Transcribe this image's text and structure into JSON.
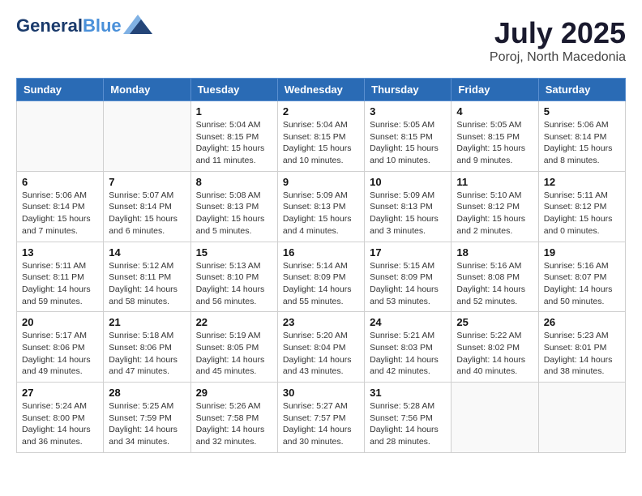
{
  "header": {
    "logo_line1": "General",
    "logo_line2": "Blue",
    "month_year": "July 2025",
    "location": "Poroj, North Macedonia"
  },
  "days_of_week": [
    "Sunday",
    "Monday",
    "Tuesday",
    "Wednesday",
    "Thursday",
    "Friday",
    "Saturday"
  ],
  "weeks": [
    [
      {
        "day": "",
        "info": ""
      },
      {
        "day": "",
        "info": ""
      },
      {
        "day": "1",
        "info": "Sunrise: 5:04 AM\nSunset: 8:15 PM\nDaylight: 15 hours and 11 minutes."
      },
      {
        "day": "2",
        "info": "Sunrise: 5:04 AM\nSunset: 8:15 PM\nDaylight: 15 hours and 10 minutes."
      },
      {
        "day": "3",
        "info": "Sunrise: 5:05 AM\nSunset: 8:15 PM\nDaylight: 15 hours and 10 minutes."
      },
      {
        "day": "4",
        "info": "Sunrise: 5:05 AM\nSunset: 8:15 PM\nDaylight: 15 hours and 9 minutes."
      },
      {
        "day": "5",
        "info": "Sunrise: 5:06 AM\nSunset: 8:14 PM\nDaylight: 15 hours and 8 minutes."
      }
    ],
    [
      {
        "day": "6",
        "info": "Sunrise: 5:06 AM\nSunset: 8:14 PM\nDaylight: 15 hours and 7 minutes."
      },
      {
        "day": "7",
        "info": "Sunrise: 5:07 AM\nSunset: 8:14 PM\nDaylight: 15 hours and 6 minutes."
      },
      {
        "day": "8",
        "info": "Sunrise: 5:08 AM\nSunset: 8:13 PM\nDaylight: 15 hours and 5 minutes."
      },
      {
        "day": "9",
        "info": "Sunrise: 5:09 AM\nSunset: 8:13 PM\nDaylight: 15 hours and 4 minutes."
      },
      {
        "day": "10",
        "info": "Sunrise: 5:09 AM\nSunset: 8:13 PM\nDaylight: 15 hours and 3 minutes."
      },
      {
        "day": "11",
        "info": "Sunrise: 5:10 AM\nSunset: 8:12 PM\nDaylight: 15 hours and 2 minutes."
      },
      {
        "day": "12",
        "info": "Sunrise: 5:11 AM\nSunset: 8:12 PM\nDaylight: 15 hours and 0 minutes."
      }
    ],
    [
      {
        "day": "13",
        "info": "Sunrise: 5:11 AM\nSunset: 8:11 PM\nDaylight: 14 hours and 59 minutes."
      },
      {
        "day": "14",
        "info": "Sunrise: 5:12 AM\nSunset: 8:11 PM\nDaylight: 14 hours and 58 minutes."
      },
      {
        "day": "15",
        "info": "Sunrise: 5:13 AM\nSunset: 8:10 PM\nDaylight: 14 hours and 56 minutes."
      },
      {
        "day": "16",
        "info": "Sunrise: 5:14 AM\nSunset: 8:09 PM\nDaylight: 14 hours and 55 minutes."
      },
      {
        "day": "17",
        "info": "Sunrise: 5:15 AM\nSunset: 8:09 PM\nDaylight: 14 hours and 53 minutes."
      },
      {
        "day": "18",
        "info": "Sunrise: 5:16 AM\nSunset: 8:08 PM\nDaylight: 14 hours and 52 minutes."
      },
      {
        "day": "19",
        "info": "Sunrise: 5:16 AM\nSunset: 8:07 PM\nDaylight: 14 hours and 50 minutes."
      }
    ],
    [
      {
        "day": "20",
        "info": "Sunrise: 5:17 AM\nSunset: 8:06 PM\nDaylight: 14 hours and 49 minutes."
      },
      {
        "day": "21",
        "info": "Sunrise: 5:18 AM\nSunset: 8:06 PM\nDaylight: 14 hours and 47 minutes."
      },
      {
        "day": "22",
        "info": "Sunrise: 5:19 AM\nSunset: 8:05 PM\nDaylight: 14 hours and 45 minutes."
      },
      {
        "day": "23",
        "info": "Sunrise: 5:20 AM\nSunset: 8:04 PM\nDaylight: 14 hours and 43 minutes."
      },
      {
        "day": "24",
        "info": "Sunrise: 5:21 AM\nSunset: 8:03 PM\nDaylight: 14 hours and 42 minutes."
      },
      {
        "day": "25",
        "info": "Sunrise: 5:22 AM\nSunset: 8:02 PM\nDaylight: 14 hours and 40 minutes."
      },
      {
        "day": "26",
        "info": "Sunrise: 5:23 AM\nSunset: 8:01 PM\nDaylight: 14 hours and 38 minutes."
      }
    ],
    [
      {
        "day": "27",
        "info": "Sunrise: 5:24 AM\nSunset: 8:00 PM\nDaylight: 14 hours and 36 minutes."
      },
      {
        "day": "28",
        "info": "Sunrise: 5:25 AM\nSunset: 7:59 PM\nDaylight: 14 hours and 34 minutes."
      },
      {
        "day": "29",
        "info": "Sunrise: 5:26 AM\nSunset: 7:58 PM\nDaylight: 14 hours and 32 minutes."
      },
      {
        "day": "30",
        "info": "Sunrise: 5:27 AM\nSunset: 7:57 PM\nDaylight: 14 hours and 30 minutes."
      },
      {
        "day": "31",
        "info": "Sunrise: 5:28 AM\nSunset: 7:56 PM\nDaylight: 14 hours and 28 minutes."
      },
      {
        "day": "",
        "info": ""
      },
      {
        "day": "",
        "info": ""
      }
    ]
  ]
}
